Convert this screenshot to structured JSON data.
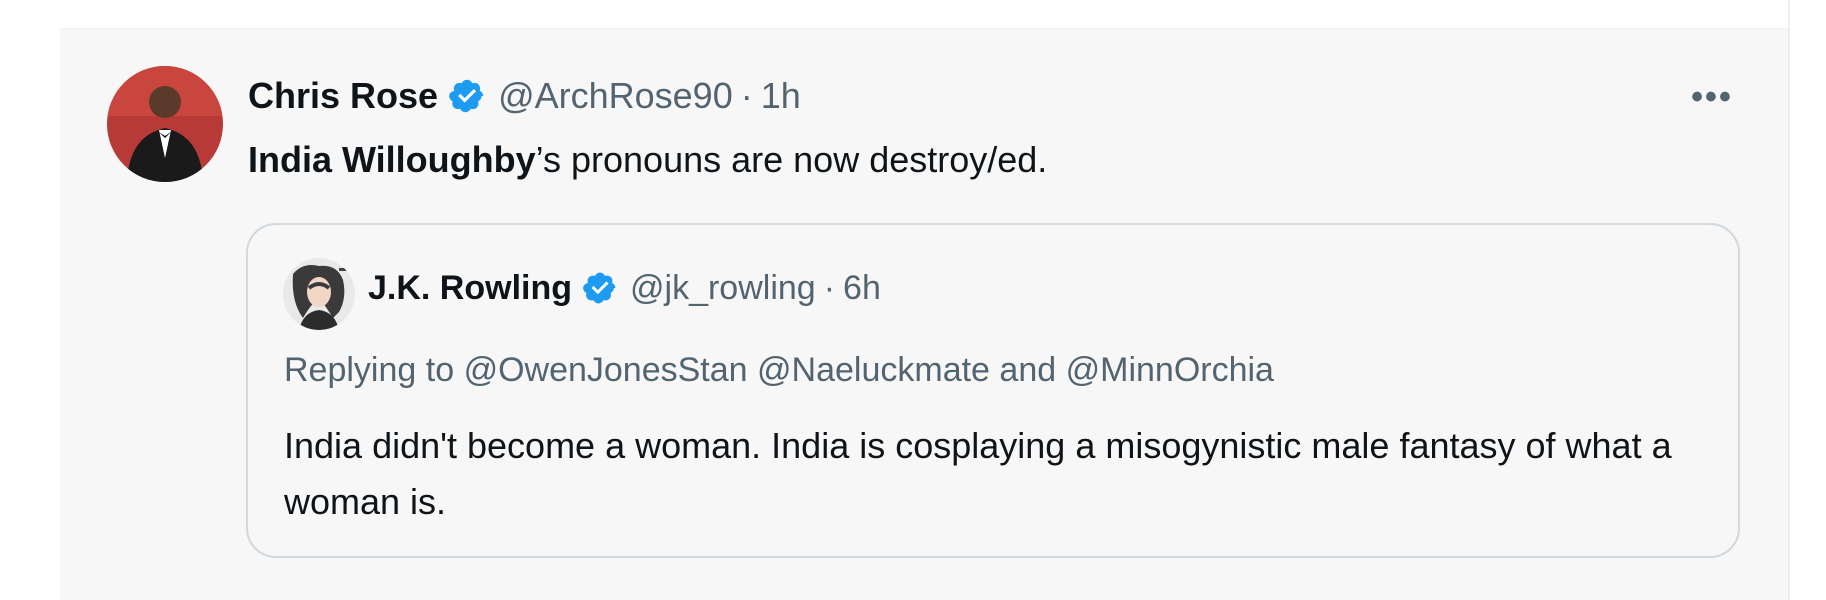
{
  "tweet": {
    "author_name": "Chris Rose",
    "author_handle": "@ArchRose90",
    "separator": "·",
    "time": "1h",
    "more_label": "•••",
    "text_bold": "India Willoughby",
    "text_rest": "’s pronouns are now destroy/ed."
  },
  "quoted_tweet": {
    "author_name": "J.K. Rowling",
    "author_handle": "@jk_rowling",
    "separator": "·",
    "time": "6h",
    "replying_prefix": "Replying to",
    "mention_1": "@OwenJonesStan",
    "mention_2": "@Naeluckmate",
    "and_word": "and",
    "mention_3": "@MinnOrchia",
    "text": "India didn't become a woman. India is cosplaying a misogynistic male fantasy of what a woman is."
  },
  "icons": {
    "verified": "verified-badge-icon",
    "more": "more-options-icon"
  },
  "colors": {
    "verified_blue": "#1d9bf0",
    "secondary_text": "#536471",
    "primary_text": "#0f1419",
    "background": "#f7f7f7",
    "border": "#cfd9de"
  }
}
